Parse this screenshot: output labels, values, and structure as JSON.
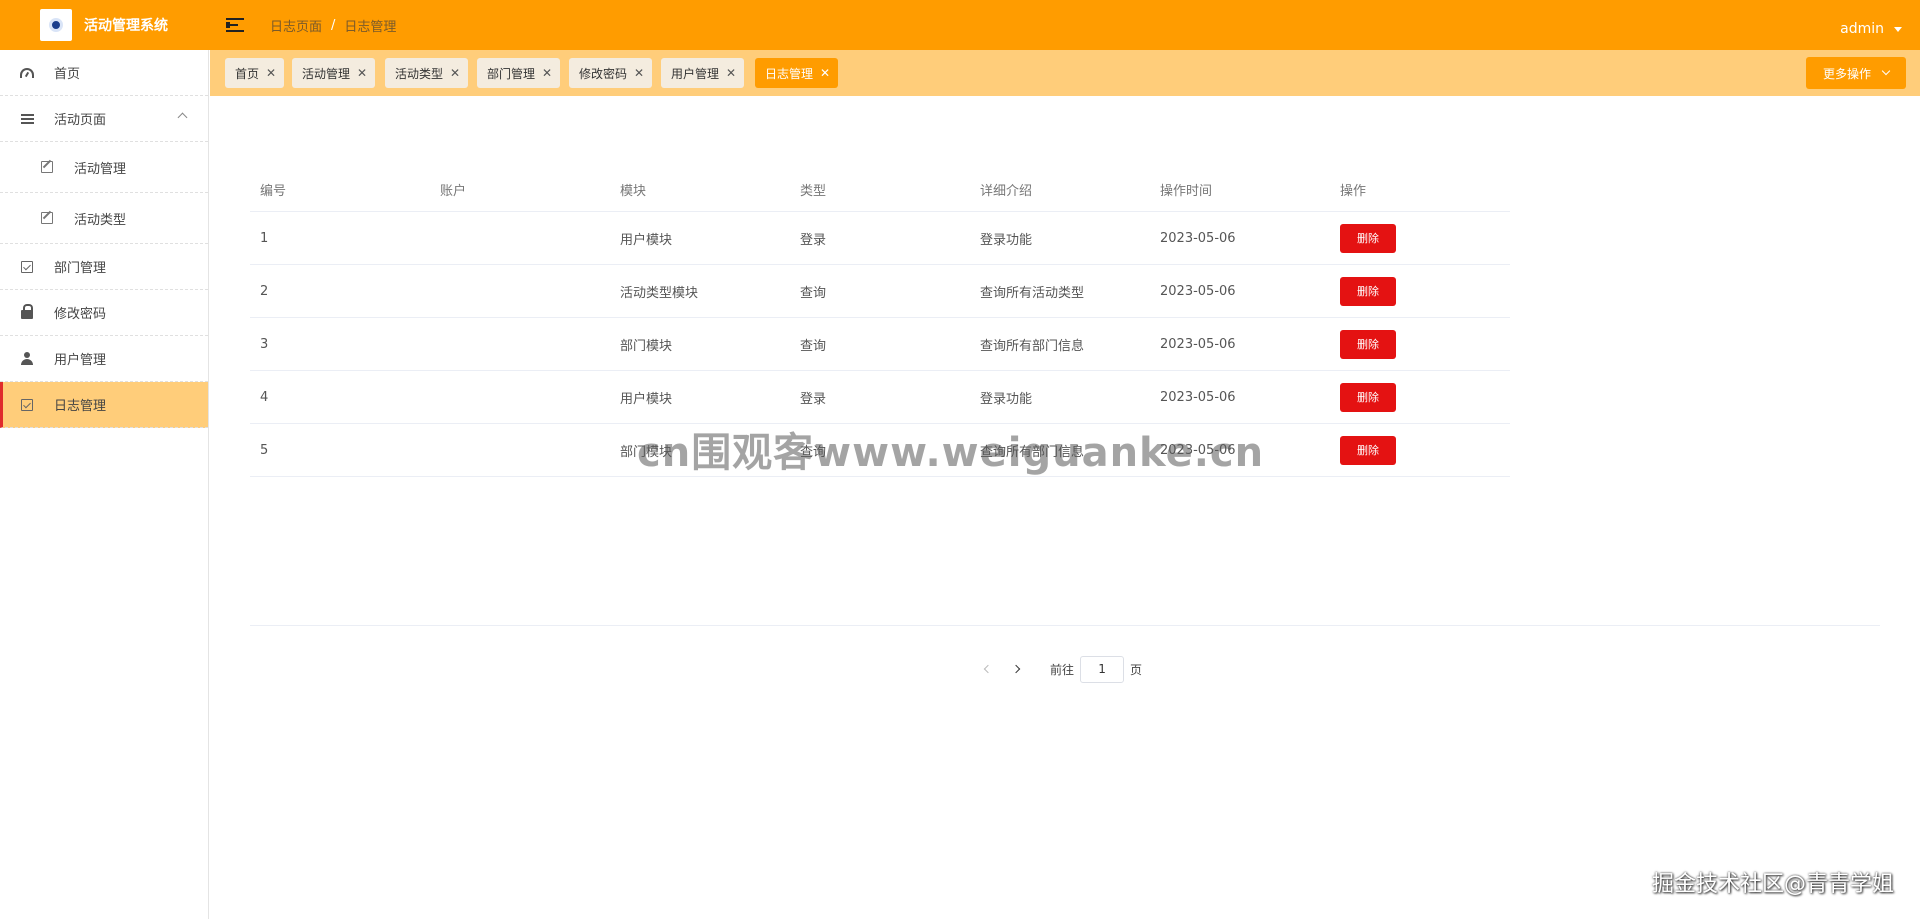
{
  "app": {
    "title": "活动管理系统",
    "user": "admin"
  },
  "breadcrumb": [
    "日志页面",
    "/",
    "日志管理"
  ],
  "sidebar": {
    "items": [
      {
        "label": "首页",
        "icon": "dashboard-icon"
      },
      {
        "label": "活动页面",
        "icon": "list-icon",
        "expanded": true
      },
      {
        "label": "活动管理",
        "icon": "edit-icon",
        "sub": true
      },
      {
        "label": "活动类型",
        "icon": "edit-icon",
        "sub": true
      },
      {
        "label": "部门管理",
        "icon": "checkbox-icon"
      },
      {
        "label": "修改密码",
        "icon": "lock-icon"
      },
      {
        "label": "用户管理",
        "icon": "user-icon"
      },
      {
        "label": "日志管理",
        "icon": "checkbox-icon",
        "active": true
      }
    ]
  },
  "tags": [
    {
      "label": "首页"
    },
    {
      "label": "活动管理"
    },
    {
      "label": "活动类型"
    },
    {
      "label": "部门管理"
    },
    {
      "label": "修改密码"
    },
    {
      "label": "用户管理"
    },
    {
      "label": "日志管理",
      "active": true
    }
  ],
  "more_button": "更多操作",
  "table": {
    "columns": [
      "编号",
      "账户",
      "模块",
      "类型",
      "详细介绍",
      "操作时间",
      "操作"
    ],
    "delete_label": "删除",
    "rows": [
      {
        "id": "1",
        "account": "",
        "module": "用户模块",
        "type": "登录",
        "detail": "登录功能",
        "time": "2023-05-06"
      },
      {
        "id": "2",
        "account": "",
        "module": "活动类型模块",
        "type": "查询",
        "detail": "查询所有活动类型",
        "time": "2023-05-06"
      },
      {
        "id": "3",
        "account": "",
        "module": "部门模块",
        "type": "查询",
        "detail": "查询所有部门信息",
        "time": "2023-05-06"
      },
      {
        "id": "4",
        "account": "",
        "module": "用户模块",
        "type": "登录",
        "detail": "登录功能",
        "time": "2023-05-06"
      },
      {
        "id": "5",
        "account": "",
        "module": "部门模块",
        "type": "查询",
        "detail": "查询所有部门信息",
        "time": "2023-05-06"
      }
    ]
  },
  "pagination": {
    "goto_label": "前往",
    "page_value": "1",
    "page_suffix": "页"
  },
  "watermarks": {
    "center": "cn围观客www.weiguanke.cn",
    "corner": "掘金技术社区@青青学姐"
  },
  "colors": {
    "primary": "#ff9c00",
    "light": "#ffcd7a",
    "danger": "#e41212"
  }
}
